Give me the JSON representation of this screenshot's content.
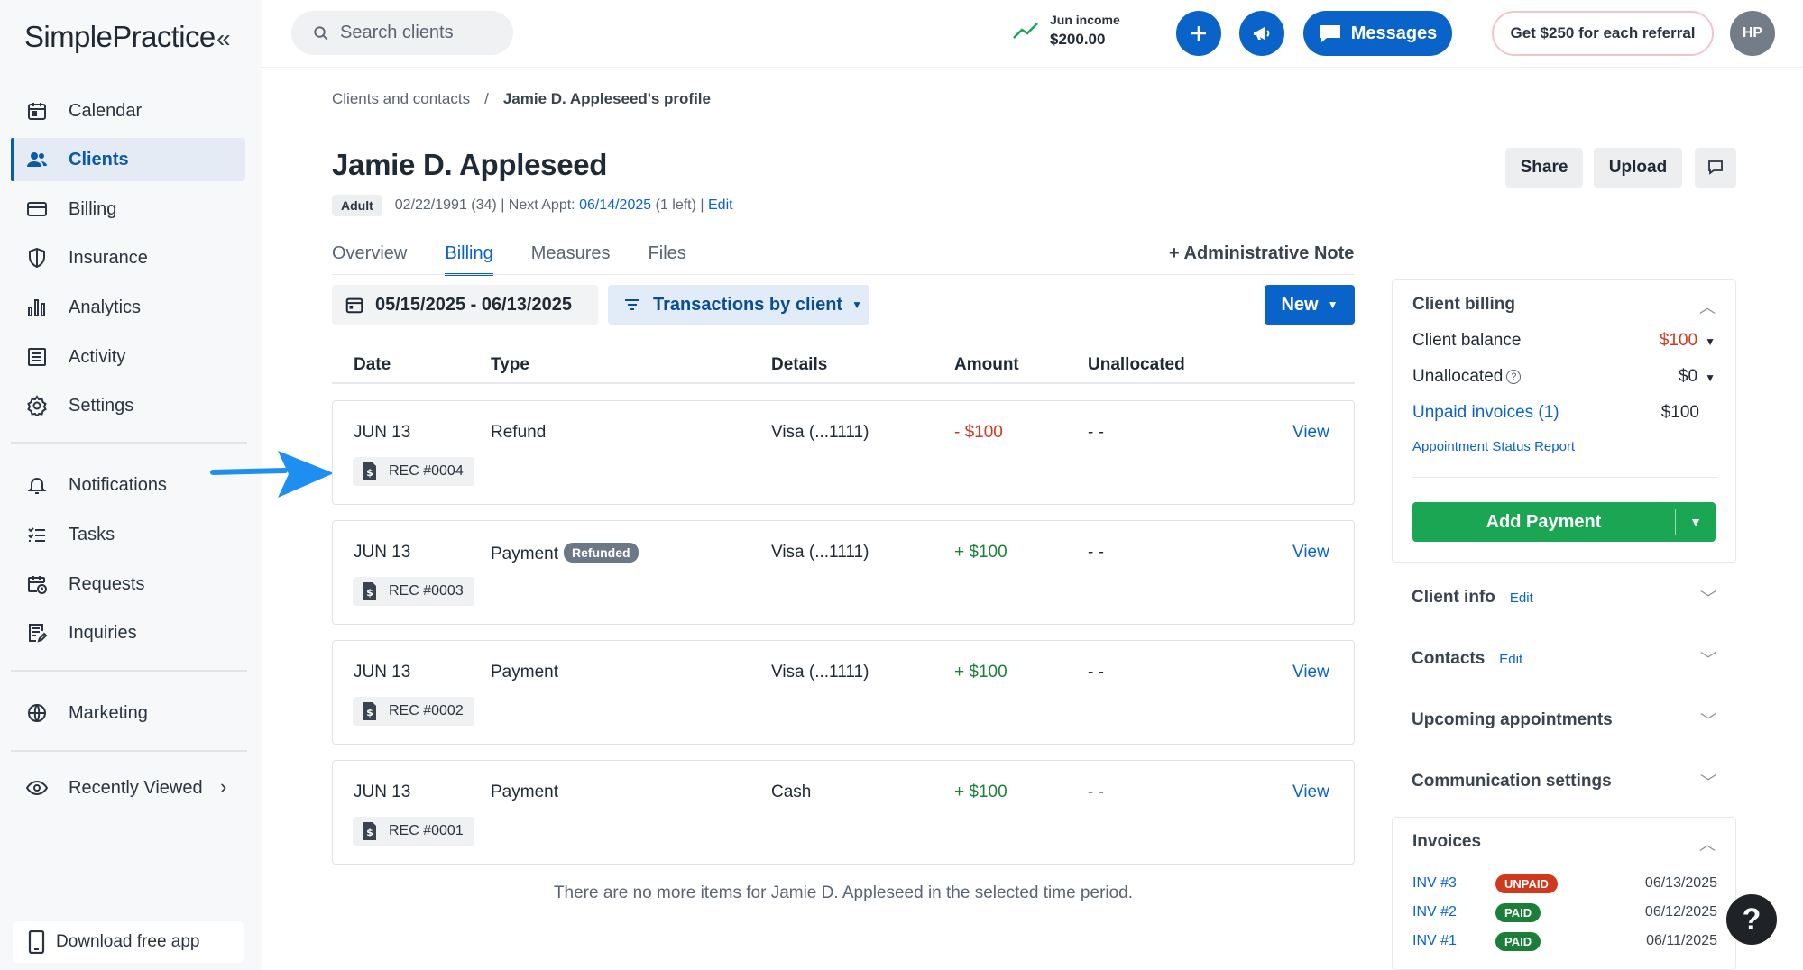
{
  "brand": {
    "logo_text": "SimplePractice",
    "accent_color": "#0a63c9"
  },
  "sidebar": {
    "collapse_icon": "double-chevron-left-icon",
    "items": [
      {
        "label": "Calendar",
        "icon": "calendar-icon",
        "active": false
      },
      {
        "label": "Clients",
        "icon": "users-icon",
        "active": true
      },
      {
        "label": "Billing",
        "icon": "credit-card-icon",
        "active": false
      },
      {
        "label": "Insurance",
        "icon": "shield-icon",
        "active": false
      },
      {
        "label": "Analytics",
        "icon": "bar-chart-icon",
        "active": false
      },
      {
        "label": "Activity",
        "icon": "list-icon",
        "active": false
      },
      {
        "label": "Settings",
        "icon": "gear-icon",
        "active": false
      },
      {
        "label": "Notifications",
        "icon": "bell-icon",
        "active": false
      },
      {
        "label": "Tasks",
        "icon": "checklist-icon",
        "active": false
      },
      {
        "label": "Requests",
        "icon": "calendar-clock-icon",
        "active": false
      },
      {
        "label": "Inquiries",
        "icon": "document-edit-icon",
        "active": false
      },
      {
        "label": "Marketing",
        "icon": "globe-icon",
        "active": false
      },
      {
        "label": "Recently Viewed",
        "icon": "eye-icon",
        "active": false
      }
    ],
    "download_app": "Download free app"
  },
  "topbar": {
    "search_placeholder": "Search clients",
    "income_label": "Jun income",
    "income_value": "$200.00",
    "messages_label": "Messages",
    "referral_label": "Get $250 for each referral",
    "avatar_initials": "HP"
  },
  "breadcrumb": {
    "parent": "Clients and contacts",
    "separator": "/",
    "current": "Jamie D. Appleseed's profile"
  },
  "client": {
    "name": "Jamie D. Appleseed",
    "badge": "Adult",
    "dob": "02/22/1991 (34) | Next Appt:",
    "next_appt": "06/14/2025",
    "appt_left": "(1 left) |",
    "edit": "Edit"
  },
  "header_buttons": {
    "share": "Share",
    "upload": "Upload"
  },
  "tabs": [
    {
      "label": "Overview",
      "active": false
    },
    {
      "label": "Billing",
      "active": true
    },
    {
      "label": "Measures",
      "active": false
    },
    {
      "label": "Files",
      "active": false
    }
  ],
  "admin_note": "+ Administrative Note",
  "filters": {
    "date_range": "05/15/2025 - 06/13/2025",
    "view": "Transactions by client",
    "new_button": "New"
  },
  "table": {
    "headers": [
      "Date",
      "Type",
      "Details",
      "Amount",
      "Unallocated"
    ],
    "rows": [
      {
        "date": "JUN 13",
        "type": "Refund",
        "badge": "",
        "details": "Visa (...1111)",
        "amount": "- $100",
        "sign": "neg",
        "unallocated": "- -",
        "action": "View",
        "receipt": "REC #0004"
      },
      {
        "date": "JUN 13",
        "type": "Payment",
        "badge": "Refunded",
        "details": "Visa (...1111)",
        "amount": "+ $100",
        "sign": "pos",
        "unallocated": "- -",
        "action": "View",
        "receipt": "REC #0003"
      },
      {
        "date": "JUN 13",
        "type": "Payment",
        "badge": "",
        "details": "Visa (...1111)",
        "amount": "+ $100",
        "sign": "pos",
        "unallocated": "- -",
        "action": "View",
        "receipt": "REC #0002"
      },
      {
        "date": "JUN 13",
        "type": "Payment",
        "badge": "",
        "details": "Cash",
        "amount": "+ $100",
        "sign": "pos",
        "unallocated": "- -",
        "action": "View",
        "receipt": "REC #0001"
      }
    ],
    "footer": "There are no more items for Jamie D. Appleseed in the selected time period."
  },
  "client_billing": {
    "title": "Client billing",
    "balance_label": "Client balance",
    "balance_value": "$100",
    "unallocated_label": "Unallocated",
    "unallocated_value": "$0",
    "unpaid_label": "Unpaid invoices (1)",
    "unpaid_value": "$100",
    "status_report": "Appointment Status Report",
    "add_payment": "Add Payment"
  },
  "sections": [
    {
      "title": "Client info",
      "edit": "Edit"
    },
    {
      "title": "Contacts",
      "edit": "Edit"
    },
    {
      "title": "Upcoming appointments",
      "edit": ""
    },
    {
      "title": "Communication settings",
      "edit": ""
    }
  ],
  "invoices": {
    "title": "Invoices",
    "items": [
      {
        "number": "INV #3",
        "status": "UNPAID",
        "date": "06/13/2025"
      },
      {
        "number": "INV #2",
        "status": "PAID",
        "date": "06/12/2025"
      },
      {
        "number": "INV #1",
        "status": "PAID",
        "date": "06/11/2025"
      }
    ]
  },
  "help_button": "?"
}
